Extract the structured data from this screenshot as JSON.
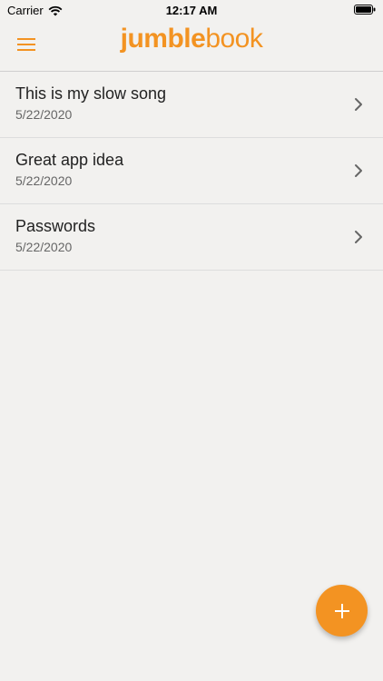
{
  "status_bar": {
    "carrier": "Carrier",
    "time": "12:17 AM"
  },
  "header": {
    "logo_part1": "jumble",
    "logo_part2": "book",
    "menu_icon": "hamburger-menu-icon",
    "accent_color": "#f39322"
  },
  "notes": [
    {
      "title": "This is my slow song",
      "date": "5/22/2020"
    },
    {
      "title": "Great app idea",
      "date": "5/22/2020"
    },
    {
      "title": "Passwords",
      "date": "5/22/2020"
    }
  ],
  "fab": {
    "icon": "plus-icon"
  }
}
